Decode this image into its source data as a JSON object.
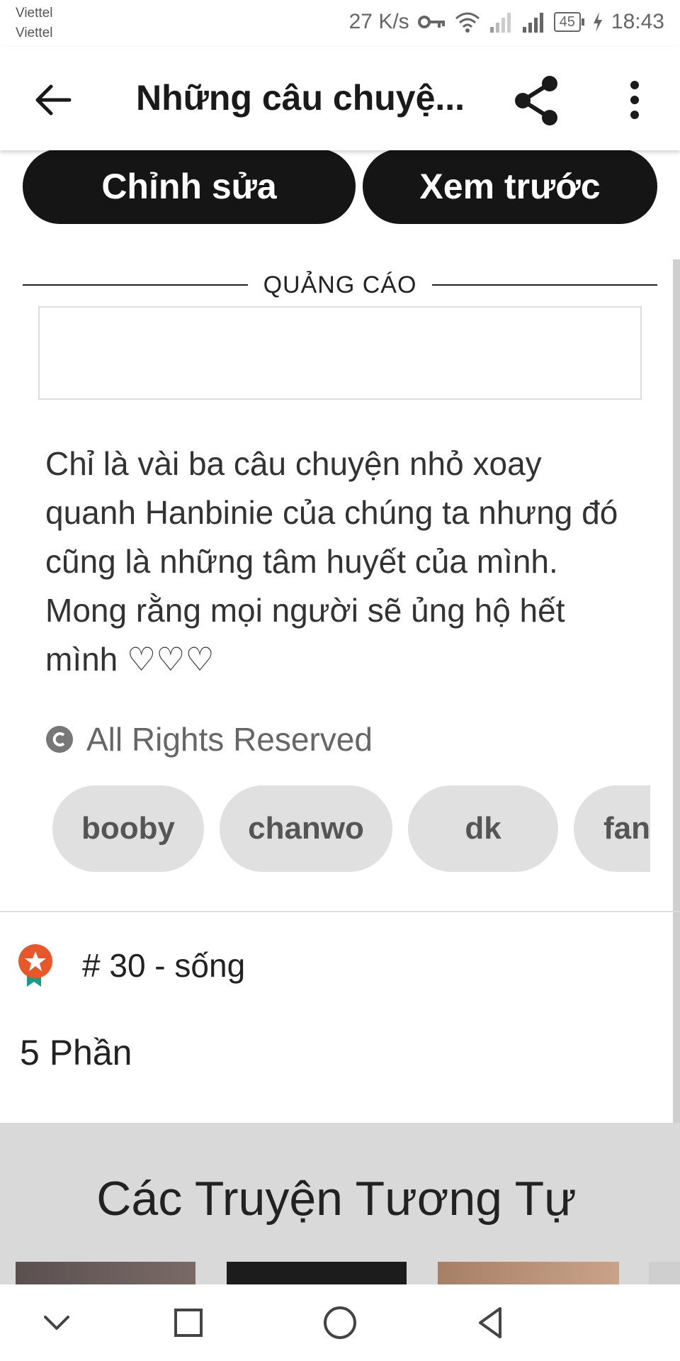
{
  "status_bar": {
    "carrier_1": "Viettel",
    "carrier_2": "Viettel",
    "speed": "27 K/s",
    "battery": "45",
    "time": "18:43"
  },
  "app_bar": {
    "title": "Những câu chuyệ..."
  },
  "actions": {
    "edit_label": "Chỉnh sửa",
    "preview_label": "Xem trước"
  },
  "ad": {
    "label": "QUẢNG CÁO"
  },
  "description": "Chỉ là vài ba câu chuyện nhỏ xoay quanh Hanbinie của chúng ta nhưng đó cũng là những tâm huyết của mình. Mong rằng mọi người sẽ ủng hộ hết mình ♡♡♡",
  "rights": "All Rights Reserved",
  "tags": [
    "booby",
    "chanwo",
    "dk",
    "fan"
  ],
  "ranking": "# 30 - sống",
  "parts": "5 Phần",
  "similar": {
    "title": "Các Truyện Tương Tự"
  },
  "icons": {
    "back": "arrow-left-icon",
    "share": "share-icon",
    "more": "more-vertical-icon",
    "copyright": "copyright-icon",
    "rank": "award-ribbon-icon",
    "nav": [
      "chevron-down-icon",
      "square-icon",
      "circle-icon",
      "triangle-back-icon"
    ]
  },
  "colors": {
    "button_bg": "#151515",
    "tag_bg": "#e0e0e0",
    "similar_bg": "#d9d9d9",
    "rank_orange": "#e8572a",
    "rank_teal": "#1a9a8a"
  }
}
